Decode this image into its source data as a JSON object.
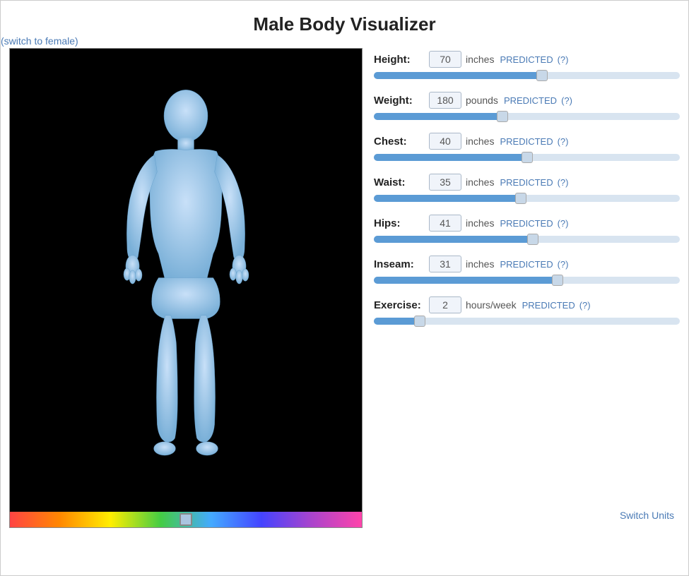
{
  "header": {
    "title": "Male Body Visualizer",
    "switch_gender_label": "(switch to female)"
  },
  "controls": [
    {
      "id": "height",
      "name": "Height:",
      "value": "70",
      "unit": "inches",
      "predicted": "PREDICTED",
      "help": "(?)",
      "fill_pct": 55
    },
    {
      "id": "weight",
      "name": "Weight:",
      "value": "180",
      "unit": "pounds",
      "predicted": "PREDICTED",
      "help": "(?)",
      "fill_pct": 42
    },
    {
      "id": "chest",
      "name": "Chest:",
      "value": "40",
      "unit": "inches",
      "predicted": "PREDICTED",
      "help": "(?)",
      "fill_pct": 50
    },
    {
      "id": "waist",
      "name": "Waist:",
      "value": "35",
      "unit": "inches",
      "predicted": "PREDICTED",
      "help": "(?)",
      "fill_pct": 48
    },
    {
      "id": "hips",
      "name": "Hips:",
      "value": "41",
      "unit": "inches",
      "predicted": "PREDICTED",
      "help": "(?)",
      "fill_pct": 52
    },
    {
      "id": "inseam",
      "name": "Inseam:",
      "value": "31",
      "unit": "inches",
      "predicted": "PREDICTED",
      "help": "(?)",
      "fill_pct": 60
    },
    {
      "id": "exercise",
      "name": "Exercise:",
      "value": "2",
      "unit": "hours/week",
      "predicted": "PREDICTED",
      "help": "(?)",
      "fill_pct": 15
    }
  ],
  "footer": {
    "switch_units": "Switch Units"
  }
}
